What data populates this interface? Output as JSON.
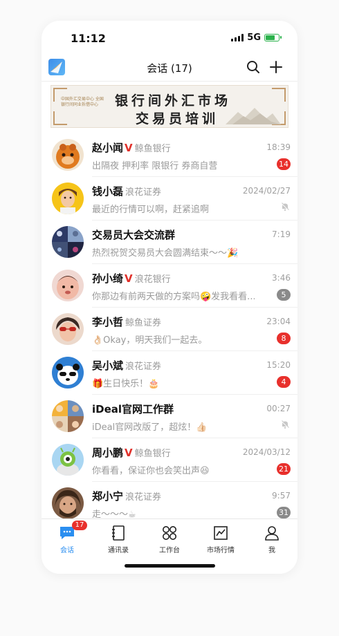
{
  "status_bar": {
    "time": "11:12",
    "network": "5G"
  },
  "nav": {
    "title": "会话 (17)"
  },
  "banner": {
    "line1": "银行间外汇市场",
    "line2": "交易员培训",
    "org": "中国外汇交易中心 全国银行间同业拆借中心"
  },
  "conversations": [
    {
      "name": "赵小闻",
      "verified": "V",
      "org": "鲸鱼银行",
      "time": "18:39",
      "message": "出隔夜  押利率  限银行 券商自营",
      "badge": "14",
      "badge_color": "#e8302c"
    },
    {
      "name": "钱小磊",
      "verified": "",
      "org": "浪花证券",
      "time": "2024/02/27",
      "message": "最近的行情可以啊，赶紧追啊",
      "muted": true
    },
    {
      "name": "交易员大会交流群",
      "verified": "",
      "org": "",
      "time": "7:19",
      "message": "热烈祝贺交易员大会圆满结束～～🎉"
    },
    {
      "name": "孙小绮",
      "verified": "V",
      "org": "浪花银行",
      "time": "3:46",
      "message": "你那边有前两天做的方案吗🤪发我看看...",
      "badge": "5",
      "badge_color": "#8a8a8a"
    },
    {
      "name": "李小哲",
      "verified": "",
      "org": "鲸鱼证券",
      "time": "23:04",
      "message": "👌🏻Okay，明天我们一起去。",
      "badge": "8",
      "badge_color": "#e8302c"
    },
    {
      "name": "吴小斌",
      "verified": "",
      "org": "浪花证券",
      "time": "15:20",
      "message": "🎁生日快乐！🎂",
      "badge": "4",
      "badge_color": "#e8302c"
    },
    {
      "name": "iDeal官网工作群",
      "verified": "",
      "org": "",
      "time": "00:27",
      "message": "iDeal官网改版了，超炫！👍🏻",
      "muted": true
    },
    {
      "name": "周小鹏",
      "verified": "V",
      "org": "鲸鱼银行",
      "time": "2024/03/12",
      "message": "你看看，保证你也会笑出声😆",
      "badge": "21",
      "badge_color": "#e8302c"
    },
    {
      "name": "郑小宁",
      "verified": "",
      "org": "浪花证券",
      "time": "9:57",
      "message": "走～～～☕",
      "badge": "31",
      "badge_color": "#8a8a8a"
    }
  ],
  "tabbar": {
    "tabs": [
      {
        "label": "会话",
        "icon": "chat-icon",
        "badge": "17"
      },
      {
        "label": "通讯录",
        "icon": "contacts-icon"
      },
      {
        "label": "工作台",
        "icon": "workbench-icon"
      },
      {
        "label": "市场行情",
        "icon": "market-chart-icon"
      },
      {
        "label": "我",
        "icon": "profile-icon"
      }
    ]
  },
  "colors": {
    "accent": "#2a8ef0",
    "badge_red": "#e8302c",
    "battery": "#2bb24c",
    "verified": "#e0302a"
  }
}
